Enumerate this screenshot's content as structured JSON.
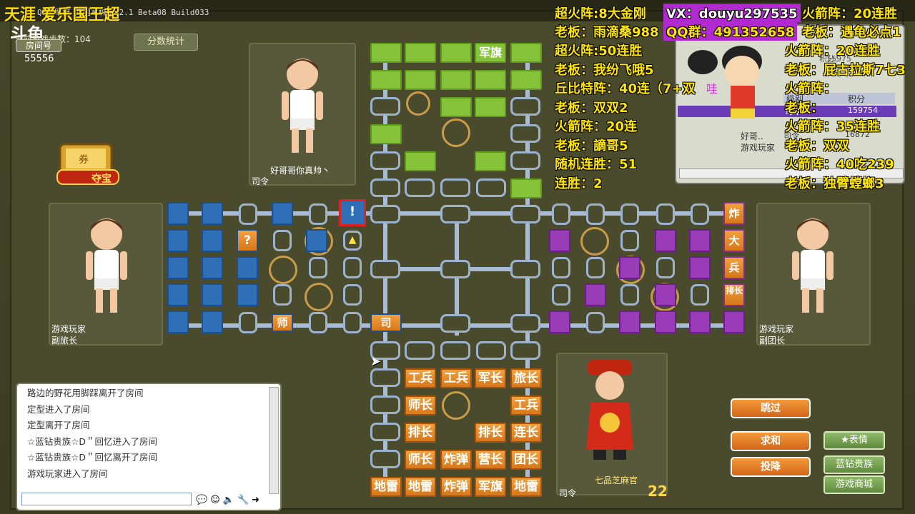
{
  "window": {
    "title": "QQ新军旗 四国军棋版 2.1 Beta08 Build033",
    "brand": "天涯    爱乐国王超"
  },
  "logo": "斗鱼",
  "room": {
    "moves_label": "当前游戏步数：104",
    "room_label": "房间号",
    "room_number": "55556"
  },
  "score_button": "分数统计",
  "treasure_label": "夺宝",
  "players": {
    "top": {
      "name": "好哥哥你真帅丶",
      "rank": "司令"
    },
    "left": {
      "name": "游戏玩家",
      "rank": "副旅长"
    },
    "right": {
      "name": "游戏玩家",
      "rank": "副团长"
    },
    "bottom": {
      "name": "七品芝麻官",
      "rank": "司令",
      "timer": "22"
    }
  },
  "board": {
    "top_flag": "军旗",
    "left_markers": [
      "!",
      "?",
      "师"
    ],
    "center_piece": "司",
    "right_vertical": [
      "炸",
      "大",
      "兵",
      "排长"
    ],
    "bottom_pieces": [
      [
        "工兵",
        "工兵",
        "军长",
        "旅长"
      ],
      [
        "师长",
        "",
        "",
        "工兵"
      ],
      [
        "排长",
        "",
        "排长",
        "连长"
      ],
      [
        "师长",
        "炸弹",
        "营长",
        "团长"
      ],
      [
        "地雷",
        "地雷",
        "炸弹",
        "军旗",
        "地雷"
      ]
    ]
  },
  "chat": {
    "messages": [
      "路边的野花用脚踩离开了房间",
      "定型进入了房间",
      "定型离开了房间",
      "☆蓝钻贵族☆D＂回忆进入了房间",
      "☆蓝钻贵族☆D＂回忆离开了房间",
      "游戏玩家进入了房间"
    ]
  },
  "scoreboard": {
    "headers": [
      "级别",
      "积分"
    ],
    "rows": [
      {
        "rank": "司令",
        "score": "159754"
      },
      {
        "rank": "司令",
        "score": "16872"
      }
    ],
    "names": [
      "好哥..",
      "游戏玩家"
    ],
    "partial": [
      "积分：",
      "15975"
    ]
  },
  "overlay": {
    "left_lines": [
      "超火阵:8大金刚",
      "老板：雨滴桑988",
      "超火阵:50连胜",
      "老板：我纷飞哦5",
      "丘比特阵：40连（7+双",
      "老板：双双2",
      "火箭阵：20连",
      "老板：謫哥5",
      "随机连胜：51",
      "连胜：2"
    ],
    "vx": "VX：douyu297535",
    "qq": "QQ群：491352658",
    "right_lines": [
      "火箭阵：20连胜",
      "老板：遇龟必点1",
      "火箭阵：20连胜",
      "老板：屁古拉斯7七3",
      "火箭阵：",
      "老板：",
      "火箭阵：35连胜",
      "老板：双双",
      "火箭阵：40吃239",
      "老板：独臂螳螂3"
    ]
  },
  "buttons": {
    "skip": "跳过",
    "draw": "求和",
    "surrender": "投降",
    "emote": "表情",
    "blue_diamond": "蓝钻贵族",
    "store": "游戏商城"
  },
  "colors": {
    "green": "#86c23a",
    "blue": "#2f6fb8",
    "purple": "#9a3cb8",
    "orange": "#e08a2a",
    "overlay_yellow": "#ffe600"
  }
}
